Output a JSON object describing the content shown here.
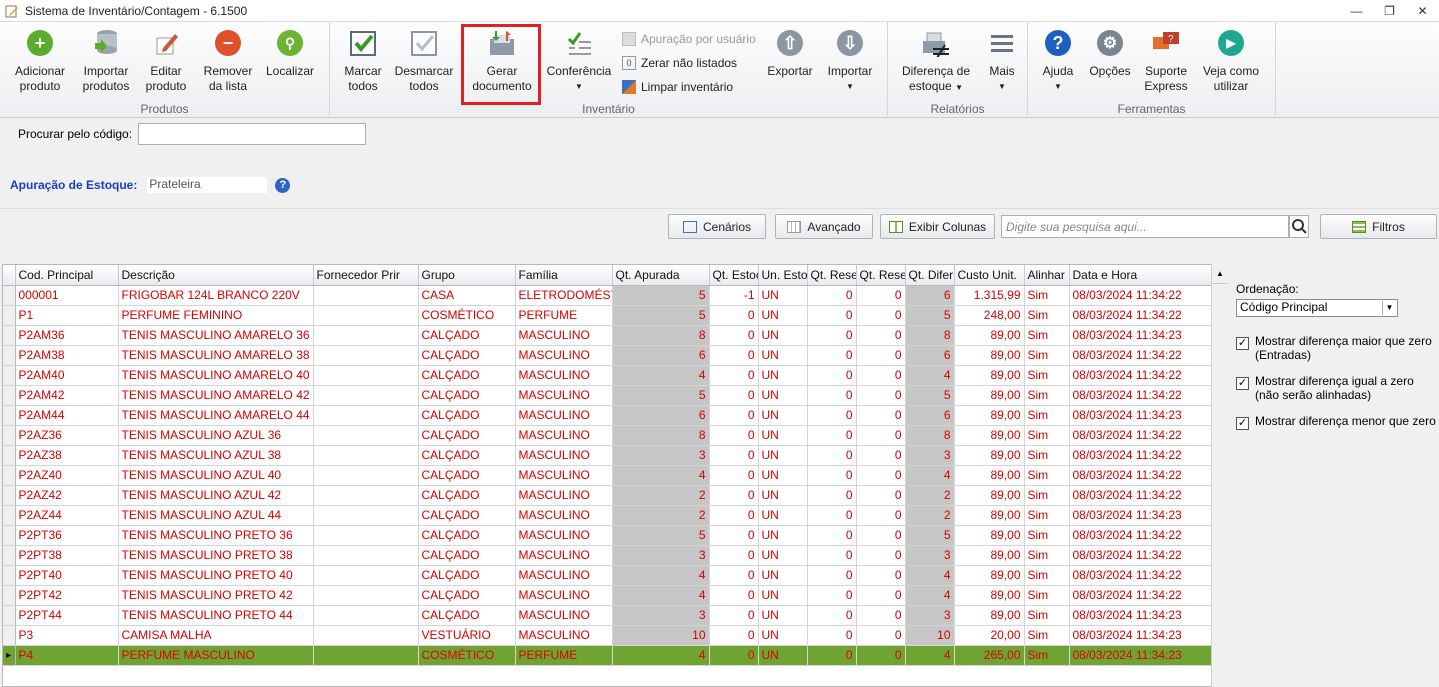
{
  "window": {
    "title": "Sistema de Inventário/Contagem - 6.1500"
  },
  "ribbon": {
    "groups": {
      "produtos": "Produtos",
      "inventario": "Inventário",
      "relatorios": "Relatórios",
      "ferramentas": "Ferramentas"
    },
    "adicionar": [
      "Adicionar",
      "produto"
    ],
    "importar_prod": [
      "Importar",
      "produtos"
    ],
    "editar": [
      "Editar",
      "produto"
    ],
    "remover": [
      "Remover",
      "da lista"
    ],
    "localizar": "Localizar",
    "marcar": [
      "Marcar",
      "todos"
    ],
    "desmarcar": [
      "Desmarcar",
      "todos"
    ],
    "gerar": [
      "Gerar",
      "documento"
    ],
    "conferencia": "Conferência",
    "apuracao_usuario": "Apuração por usuário",
    "zerar": "Zerar não listados",
    "limpar": "Limpar inventário",
    "exportar": "Exportar",
    "importar": "Importar",
    "diferenca": [
      "Diferença de",
      "estoque"
    ],
    "mais": "Mais",
    "ajuda": "Ajuda",
    "opcoes": "Opções",
    "suporte": [
      "Suporte",
      "Express"
    ],
    "veja": [
      "Veja como",
      "utilizar"
    ],
    "zero_badge": "0"
  },
  "search": {
    "label": "Procurar pelo código:"
  },
  "apuracao": {
    "label": "Apuração de Estoque:",
    "value": "Prateleira"
  },
  "toolbar": {
    "cenarios": "Cenários",
    "avancado": "Avançado",
    "exibir": "Exibir Colunas",
    "search_placeholder": "Digite sua pesquisa aqui...",
    "filtros": "Filtros"
  },
  "columns": [
    "Cod. Principal",
    "Descrição",
    "Fornecedor Prir",
    "Grupo",
    "Família",
    "Qt. Apurada",
    "Qt. Estoc",
    "Un. Esto",
    "Qt. Rese",
    "Qt. Rese",
    "Qt. Difer",
    "Custo Unit.",
    "Alinhar",
    "Data e Hora"
  ],
  "rows": [
    [
      "000001",
      "FRIGOBAR 124L BRANCO 220V",
      "",
      "CASA",
      "ELETRODOMÉSTICO",
      "5",
      "-1",
      "UN",
      "0",
      "0",
      "6",
      "1.315,99",
      "Sim",
      "08/03/2024 11:34:22"
    ],
    [
      "P1",
      "PERFUME FEMININO",
      "",
      "COSMÉTICO",
      "PERFUME",
      "5",
      "0",
      "UN",
      "0",
      "0",
      "5",
      "248,00",
      "Sim",
      "08/03/2024 11:34:22"
    ],
    [
      "P2AM36",
      "TENIS MASCULINO AMARELO 36",
      "",
      "CALÇADO",
      "MASCULINO",
      "8",
      "0",
      "UN",
      "0",
      "0",
      "8",
      "89,00",
      "Sim",
      "08/03/2024 11:34:23"
    ],
    [
      "P2AM38",
      "TENIS MASCULINO AMARELO 38",
      "",
      "CALÇADO",
      "MASCULINO",
      "6",
      "0",
      "UN",
      "0",
      "0",
      "6",
      "89,00",
      "Sim",
      "08/03/2024 11:34:22"
    ],
    [
      "P2AM40",
      "TENIS MASCULINO AMARELO 40",
      "",
      "CALÇADO",
      "MASCULINO",
      "4",
      "0",
      "UN",
      "0",
      "0",
      "4",
      "89,00",
      "Sim",
      "08/03/2024 11:34:22"
    ],
    [
      "P2AM42",
      "TENIS MASCULINO AMARELO 42",
      "",
      "CALÇADO",
      "MASCULINO",
      "5",
      "0",
      "UN",
      "0",
      "0",
      "5",
      "89,00",
      "Sim",
      "08/03/2024 11:34:22"
    ],
    [
      "P2AM44",
      "TENIS MASCULINO AMARELO 44",
      "",
      "CALÇADO",
      "MASCULINO",
      "6",
      "0",
      "UN",
      "0",
      "0",
      "6",
      "89,00",
      "Sim",
      "08/03/2024 11:34:23"
    ],
    [
      "P2AZ36",
      "TENIS MASCULINO AZUL 36",
      "",
      "CALÇADO",
      "MASCULINO",
      "8",
      "0",
      "UN",
      "0",
      "0",
      "8",
      "89,00",
      "Sim",
      "08/03/2024 11:34:22"
    ],
    [
      "P2AZ38",
      "TENIS MASCULINO AZUL 38",
      "",
      "CALÇADO",
      "MASCULINO",
      "3",
      "0",
      "UN",
      "0",
      "0",
      "3",
      "89,00",
      "Sim",
      "08/03/2024 11:34:22"
    ],
    [
      "P2AZ40",
      "TENIS MASCULINO AZUL 40",
      "",
      "CALÇADO",
      "MASCULINO",
      "4",
      "0",
      "UN",
      "0",
      "0",
      "4",
      "89,00",
      "Sim",
      "08/03/2024 11:34:22"
    ],
    [
      "P2AZ42",
      "TENIS MASCULINO AZUL 42",
      "",
      "CALÇADO",
      "MASCULINO",
      "2",
      "0",
      "UN",
      "0",
      "0",
      "2",
      "89,00",
      "Sim",
      "08/03/2024 11:34:22"
    ],
    [
      "P2AZ44",
      "TENIS MASCULINO AZUL 44",
      "",
      "CALÇADO",
      "MASCULINO",
      "2",
      "0",
      "UN",
      "0",
      "0",
      "2",
      "89,00",
      "Sim",
      "08/03/2024 11:34:23"
    ],
    [
      "P2PT36",
      "TENIS MASCULINO PRETO 36",
      "",
      "CALÇADO",
      "MASCULINO",
      "5",
      "0",
      "UN",
      "0",
      "0",
      "5",
      "89,00",
      "Sim",
      "08/03/2024 11:34:22"
    ],
    [
      "P2PT38",
      "TENIS MASCULINO PRETO 38",
      "",
      "CALÇADO",
      "MASCULINO",
      "3",
      "0",
      "UN",
      "0",
      "0",
      "3",
      "89,00",
      "Sim",
      "08/03/2024 11:34:22"
    ],
    [
      "P2PT40",
      "TENIS MASCULINO PRETO 40",
      "",
      "CALÇADO",
      "MASCULINO",
      "4",
      "0",
      "UN",
      "0",
      "0",
      "4",
      "89,00",
      "Sim",
      "08/03/2024 11:34:22"
    ],
    [
      "P2PT42",
      "TENIS MASCULINO PRETO 42",
      "",
      "CALÇADO",
      "MASCULINO",
      "4",
      "0",
      "UN",
      "0",
      "0",
      "4",
      "89,00",
      "Sim",
      "08/03/2024 11:34:22"
    ],
    [
      "P2PT44",
      "TENIS MASCULINO PRETO 44",
      "",
      "CALÇADO",
      "MASCULINO",
      "3",
      "0",
      "UN",
      "0",
      "0",
      "3",
      "89,00",
      "Sim",
      "08/03/2024 11:34:23"
    ],
    [
      "P3",
      "CAMISA MALHA",
      "",
      "VESTUÁRIO",
      "MASCULINO",
      "10",
      "0",
      "UN",
      "0",
      "0",
      "10",
      "20,00",
      "Sim",
      "08/03/2024 11:34:23"
    ],
    [
      "P4",
      "PERFUME MASCULINO",
      "",
      "COSMÉTICO",
      "PERFUME",
      "4",
      "0",
      "UN",
      "0",
      "0",
      "4",
      "265,00",
      "Sim",
      "08/03/2024 11:34:23"
    ]
  ],
  "selected_row": 18,
  "sidepanel": {
    "ordenacao_label": "Ordenação:",
    "ordenacao_value": "Código Principal",
    "checks": [
      {
        "label": "Mostrar diferença maior que zero (Entradas)",
        "checked": true
      },
      {
        "label": "Mostrar diferença igual a zero (não serão alinhadas)",
        "checked": true
      },
      {
        "label": "Mostrar diferença menor que zero",
        "checked": true
      }
    ]
  },
  "colors": {
    "row_text": "#d40000",
    "selected_row": "#6fa332",
    "highlight_box": "#e01f26",
    "apuracao_label": "#1a3dbd"
  }
}
